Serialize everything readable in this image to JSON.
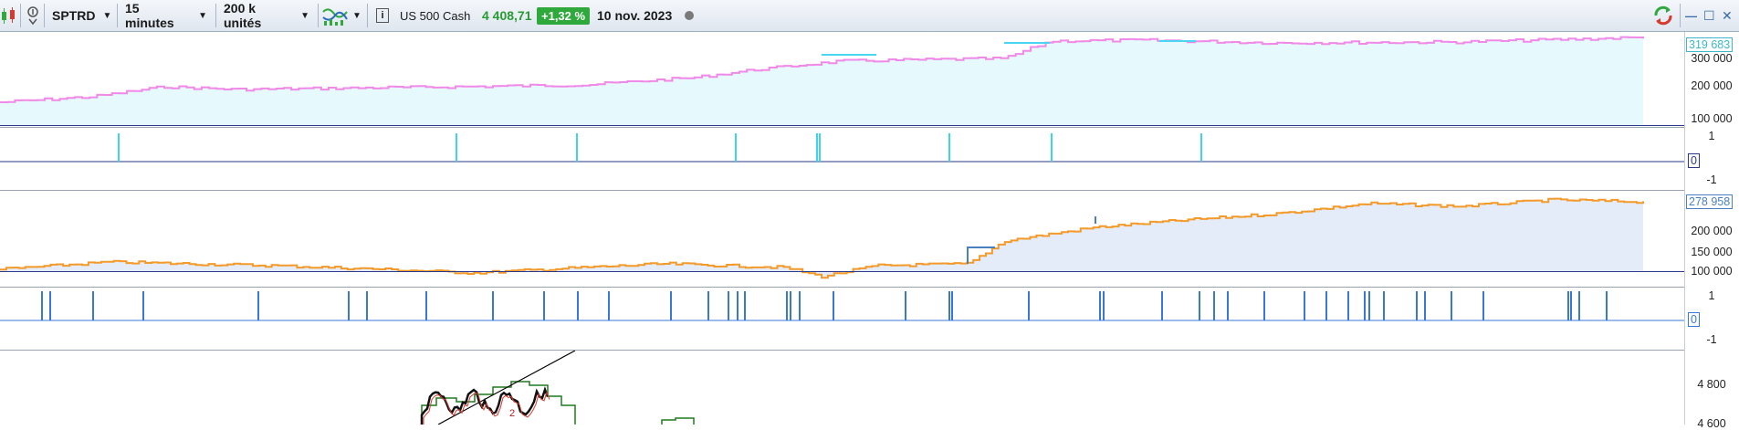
{
  "toolbar": {
    "ticker": "SPTRD",
    "timeframe": "15 minutes",
    "units": "200 k unités",
    "instrument": "US 500 Cash",
    "price": "4 408,71",
    "change": "+1,32 %",
    "date": "10 nov. 2023",
    "minimize": "—",
    "maximize": "☐",
    "close": "✕",
    "colors": {
      "up": "#2fa83c",
      "accent": "#4a7fc0"
    }
  },
  "panel1": {
    "ticks": [
      "300 000",
      "200 000",
      "100 000"
    ],
    "last_value": "319 683",
    "colors": {
      "line": "#f089e8",
      "fill": "#e6f9fd",
      "step": "#4ad6f0"
    }
  },
  "panel2": {
    "ticks": [
      "1",
      "0",
      "-1"
    ],
    "zero_label": "0",
    "colors": {
      "bar": "#3fd3ef"
    }
  },
  "panel3": {
    "ticks": [
      "200 000",
      "150 000",
      "100 000"
    ],
    "last_value": "278 958",
    "colors": {
      "line": "#f39a2a",
      "step": "#4a7fc0",
      "fill": "#e4ecf9"
    }
  },
  "panel4": {
    "ticks": [
      "1",
      "0",
      "-1"
    ],
    "zero_label": "0",
    "colors": {
      "bar": "#3a78d8"
    }
  },
  "panel5": {
    "ticks": [
      "4 800",
      "4 600"
    ],
    "annotation": "2"
  }
}
